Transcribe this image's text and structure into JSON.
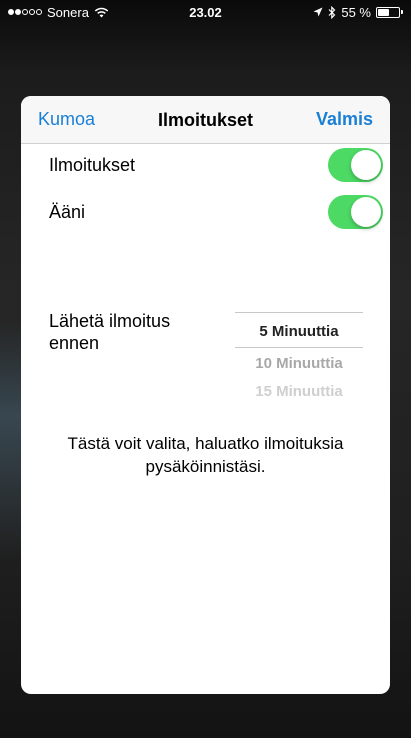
{
  "status_bar": {
    "carrier": "Sonera",
    "time": "23.02",
    "battery_percent": "55 %",
    "battery_level": 0.55,
    "signal_bars_filled": 2,
    "signal_bars_total": 5,
    "icons": [
      "wifi-icon",
      "location-arrow-icon",
      "bluetooth-icon",
      "battery-icon"
    ]
  },
  "nav": {
    "cancel_label": "Kumoa",
    "title": "Ilmoitukset",
    "done_label": "Valmis"
  },
  "settings": {
    "notifications_label": "Ilmoitukset",
    "notifications_on": true,
    "sound_label": "Ääni",
    "sound_on": true
  },
  "picker": {
    "label": "Lähetä ilmoitus ennen",
    "options": [
      "5 Minuuttia",
      "10 Minuuttia",
      "15 Minuuttia"
    ],
    "selected": "5 Minuuttia"
  },
  "info_text": "Tästä voit valita, haluatko ilmoituksia pysäköinnistäsi.",
  "colors": {
    "accent": "#1a7fd5",
    "toggle_on": "#4cd964"
  }
}
